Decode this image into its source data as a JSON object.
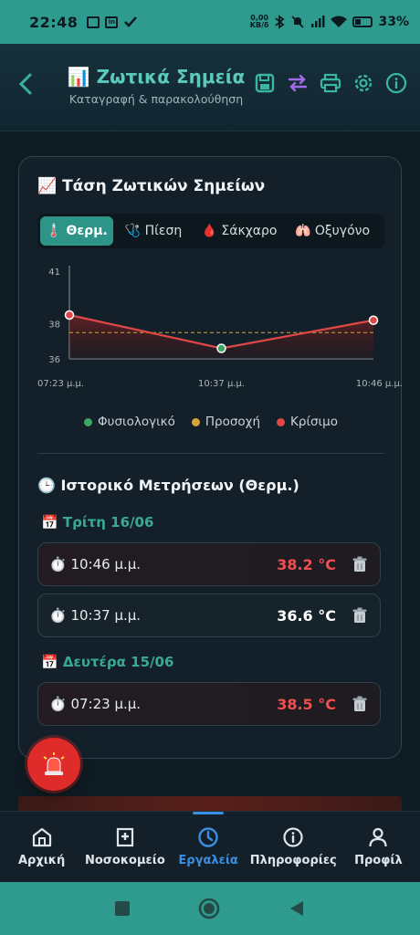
{
  "status_bar": {
    "time": "22:48",
    "net_speed_value": "0,00",
    "net_speed_unit": "KB/δ",
    "battery": "33%"
  },
  "app_bar": {
    "title": "📊 Ζωτικά Σημεία",
    "subtitle": "Καταγραφή & παρακολούθηση",
    "icons": [
      "back-icon",
      "save-icon",
      "swap-icon",
      "print-icon",
      "settings-icon",
      "info-icon"
    ]
  },
  "trend": {
    "title": "📈 Τάση Ζωτικών Σημείων",
    "tabs": [
      {
        "label": "🌡️ Θερμ.",
        "active": true
      },
      {
        "label": "🩺 Πίεση",
        "active": false
      },
      {
        "label": "🩸 Σάκχαρο",
        "active": false
      },
      {
        "label": "🫁 Οξυγόνο",
        "active": false
      }
    ]
  },
  "chart_data": {
    "type": "line",
    "x": [
      "07:23 μ.μ.",
      "10:37 μ.μ.",
      "10:46 μ.μ."
    ],
    "y_ticks": [
      "41",
      "38",
      "36"
    ],
    "ylim": [
      36,
      41
    ],
    "series": [
      {
        "values": [
          38.5,
          36.6,
          38.2
        ],
        "point_status": [
          "critical",
          "normal",
          "critical"
        ]
      }
    ],
    "threshold": 37.5,
    "colors": {
      "line": "#e04848",
      "threshold": "#d4a53a",
      "normal": "#3aa860",
      "warning": "#d4a53a",
      "critical": "#e04848"
    }
  },
  "legend": [
    {
      "label": "Φυσιολογικό",
      "color": "#3aa860"
    },
    {
      "label": "Προσοχή",
      "color": "#d4a53a"
    },
    {
      "label": "Κρίσιμο",
      "color": "#e04848"
    }
  ],
  "history": {
    "title": "🕒 Ιστορικό Μετρήσεων (Θερμ.)",
    "groups": [
      {
        "day": "📅 Τρίτη 16/06",
        "rows": [
          {
            "time": "⏱️ 10:46 μ.μ.",
            "value": "38.2 °C",
            "status": "critical"
          },
          {
            "time": "⏱️ 10:37 μ.μ.",
            "value": "36.6 °C",
            "status": "normal"
          }
        ]
      },
      {
        "day": "📅 Δευτέρα 15/06",
        "rows": [
          {
            "time": "⏱️ 07:23 μ.μ.",
            "value": "38.5 °C",
            "status": "critical"
          }
        ]
      }
    ]
  },
  "fab": {
    "icon": "siren-icon"
  },
  "bottom_nav": [
    {
      "label": "Αρχική",
      "icon": "home-icon",
      "active": false
    },
    {
      "label": "Νοσοκομείο",
      "icon": "hospital-icon",
      "active": false
    },
    {
      "label": "Εργαλεία",
      "icon": "clock-icon",
      "active": true
    },
    {
      "label": "Πληροφορίες",
      "icon": "info-circle-icon",
      "active": false
    },
    {
      "label": "Προφίλ",
      "icon": "user-icon",
      "active": false
    }
  ]
}
